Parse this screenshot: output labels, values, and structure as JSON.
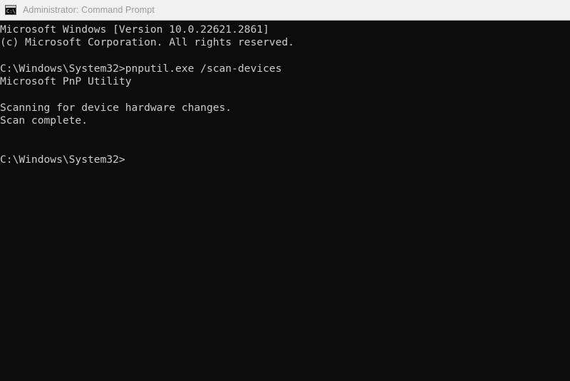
{
  "window": {
    "title": "Administrator: Command Prompt",
    "icon": "command-prompt-icon",
    "icon_glyph": "C:\\",
    "titlebar_bg": "#f0f0f0",
    "titlebar_text_color": "#9a9a9a",
    "console_bg": "#0c0c0c",
    "console_text_color": "#cccccc"
  },
  "console": {
    "lines": [
      "Microsoft Windows [Version 10.0.22621.2861]",
      "(c) Microsoft Corporation. All rights reserved.",
      "",
      "C:\\Windows\\System32>pnputil.exe /scan-devices",
      "Microsoft PnP Utility",
      "",
      "Scanning for device hardware changes.",
      "Scan complete.",
      "",
      "",
      "C:\\Windows\\System32>"
    ],
    "prompt": "C:\\Windows\\System32>",
    "command": "pnputil.exe /scan-devices",
    "os_version": "10.0.22621.2861",
    "utility_name": "Microsoft PnP Utility",
    "status_messages": [
      "Scanning for device hardware changes.",
      "Scan complete."
    ]
  }
}
